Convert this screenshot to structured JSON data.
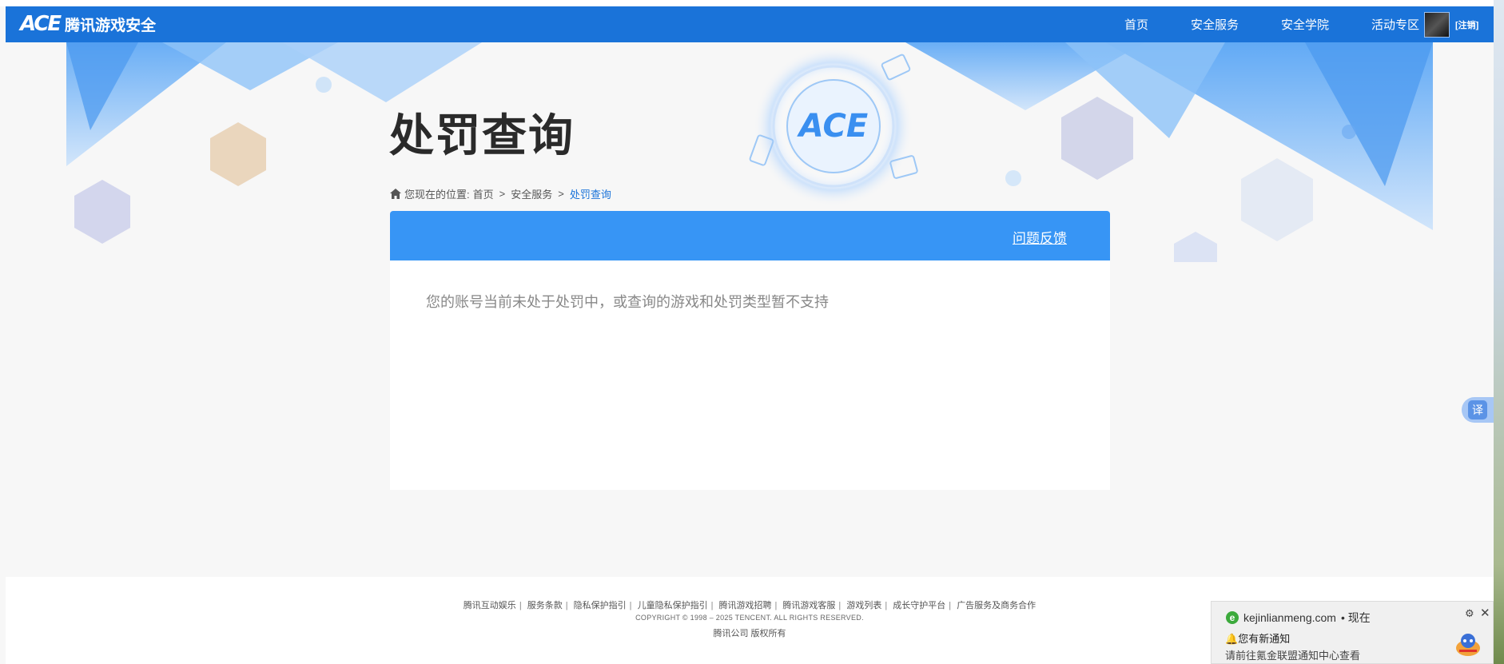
{
  "header": {
    "logo_mark": "ACE",
    "logo_text": "腾讯游戏安全",
    "nav": [
      "首页",
      "安全服务",
      "安全学院",
      "活动专区"
    ],
    "logout": "[注销]"
  },
  "page": {
    "title": "处罚查询",
    "breadcrumb": {
      "prefix": "您现在的位置:",
      "items": [
        "首页",
        "安全服务"
      ],
      "current": "处罚查询"
    }
  },
  "panel": {
    "feedback": "问题反馈",
    "message": "您的账号当前未处于处罚中，或查询的游戏和处罚类型暂不支持"
  },
  "footer": {
    "links": [
      "腾讯互动娱乐",
      "服务条款",
      "隐私保护指引",
      "儿童隐私保护指引",
      "腾讯游戏招聘",
      "腾讯游戏客服",
      "游戏列表",
      "成长守护平台",
      "广告服务及商务合作"
    ],
    "copyright": "COPYRIGHT © 1998 – 2025 TENCENT. ALL RIGHTS RESERVED.",
    "rights": "腾讯公司 版权所有"
  },
  "translate": {
    "label": "译"
  },
  "notification": {
    "source": "kejinlianmeng.com",
    "time": "• 现在",
    "title": "您有新通知",
    "body": "请前往氪金联盟通知中心查看"
  },
  "colors": {
    "header": "#1a73d9",
    "panel_head": "#3795f5",
    "link_current": "#1a73d9"
  }
}
